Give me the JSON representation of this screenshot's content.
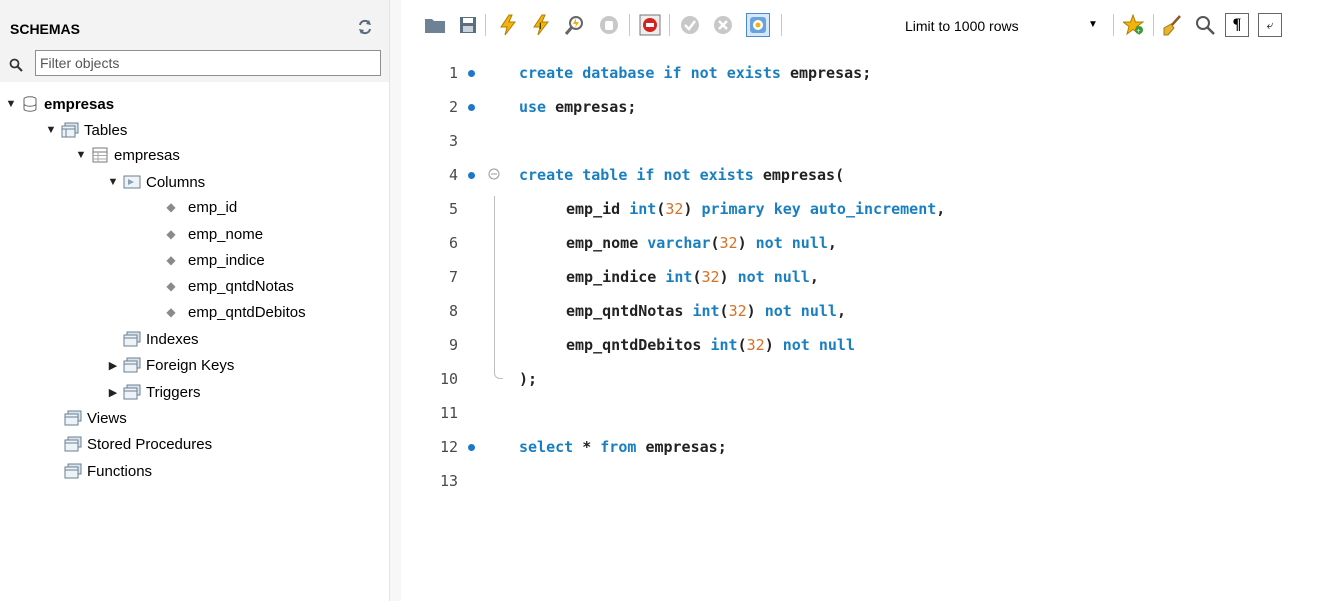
{
  "schemas": {
    "title": "SCHEMAS",
    "filter_placeholder": "Filter objects",
    "tree": {
      "schema": "empresas",
      "tables": "Tables",
      "table": "empresas",
      "columns": "Columns",
      "column_items": [
        "emp_id",
        "emp_nome",
        "emp_indice",
        "emp_qntdNotas",
        "emp_qntdDebitos"
      ],
      "indexes": "Indexes",
      "foreign_keys": "Foreign Keys",
      "triggers": "Triggers",
      "views": "Views",
      "stored_procedures": "Stored Procedures",
      "functions": "Functions"
    }
  },
  "toolbar": {
    "limit_label": "Limit to 1000 rows",
    "icons": [
      "open-folder-icon",
      "save-icon",
      "execute-icon",
      "execute-current-icon",
      "explain-icon",
      "stop-icon",
      "toggle-error-icon",
      "commit-icon",
      "rollback-icon",
      "autocommit-icon",
      "limit-dropdown",
      "bookmark-icon",
      "beautify-icon",
      "find-icon",
      "invisible-chars-icon",
      "wrap-icon"
    ]
  },
  "editor": {
    "lines": [
      {
        "n": "1",
        "dot": true
      },
      {
        "n": "2",
        "dot": true
      },
      {
        "n": "3",
        "dot": false
      },
      {
        "n": "4",
        "dot": true
      },
      {
        "n": "5",
        "dot": false
      },
      {
        "n": "6",
        "dot": false
      },
      {
        "n": "7",
        "dot": false
      },
      {
        "n": "8",
        "dot": false
      },
      {
        "n": "9",
        "dot": false
      },
      {
        "n": "10",
        "dot": false
      },
      {
        "n": "11",
        "dot": false
      },
      {
        "n": "12",
        "dot": true
      },
      {
        "n": "13",
        "dot": false
      }
    ],
    "code": {
      "l1": {
        "k1": "create database if not exists",
        "id": "empresas",
        "end": ";"
      },
      "l2": {
        "k1": "use",
        "id": "empresas",
        "end": ";"
      },
      "l4": {
        "k1": "create table if not exists",
        "id": "empresas",
        "end": "("
      },
      "l5": {
        "id": "emp_id",
        "type": "int",
        "n1": "32",
        "rest": "primary key auto_increment",
        "end": ","
      },
      "l6": {
        "id": "emp_nome",
        "type": "varchar",
        "n1": "32",
        "rest": "not null",
        "end": ","
      },
      "l7": {
        "id": "emp_indice",
        "type": "int",
        "n1": "32",
        "rest": "not null",
        "end": ","
      },
      "l8": {
        "id": "emp_qntdNotas",
        "type": "int",
        "n1": "32",
        "rest": "not null",
        "end": ","
      },
      "l9": {
        "id": "emp_qntdDebitos",
        "type": "int",
        "n1": "32",
        "rest": "not null",
        "end": ""
      },
      "l10": {
        "end": ");"
      },
      "l12": {
        "k1": "select",
        "star": "*",
        "k2": "from",
        "id": "empresas",
        "end": ";"
      }
    }
  },
  "colors": {
    "keyword": "#1a7fc1",
    "number": "#d67022",
    "marker": "#1e78c8"
  }
}
